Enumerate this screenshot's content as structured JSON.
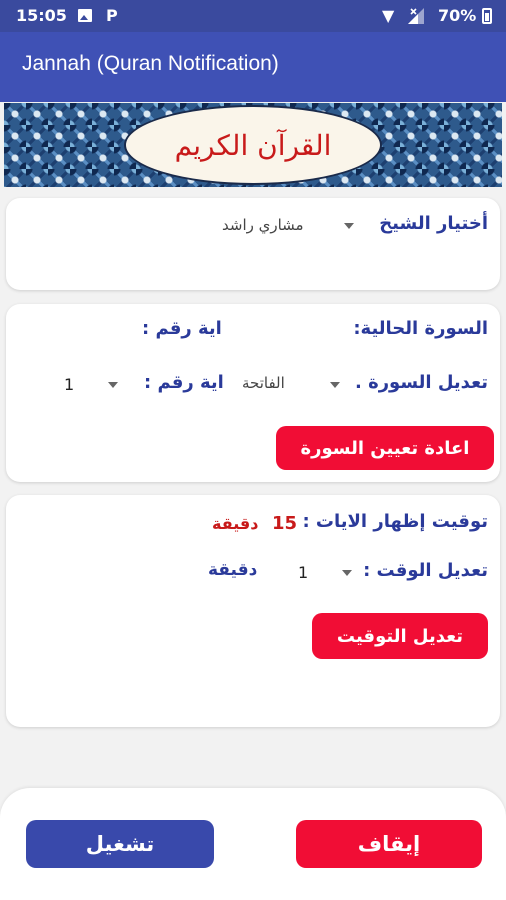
{
  "status_bar": {
    "time": "15:05",
    "p_icon": "P",
    "battery": "70%",
    "icons": [
      "photo-icon",
      "p-icon",
      "wifi-icon",
      "signal-icon",
      "battery-icon"
    ]
  },
  "app_bar": {
    "title": "Jannah (Quran Notification)",
    "color": "#3f51b5"
  },
  "banner": {
    "title": "القرآن الكريم"
  },
  "reciter": {
    "label": "أختيار الشيخ",
    "selected": "مشاري راشد"
  },
  "current": {
    "surah_label": "السورة الحالية:",
    "ayah_label": "اية رقم :"
  },
  "edit_surah": {
    "surah_label": "تعديل السورة .",
    "surah_selected": "الفاتحة",
    "ayah_label": "اية رقم :",
    "ayah_selected": "1",
    "reset_button": "اعادة تعيين السورة"
  },
  "timing": {
    "label": "توقيت إظهار الايات :",
    "value": "15",
    "unit": "دقيقة",
    "edit_label": "تعديل الوقت :",
    "edit_selected": "1",
    "edit_unit": "دقيقة",
    "edit_button": "تعديل التوقيت"
  },
  "controls": {
    "start_button": "تشغيل",
    "stop_button": "إيقاف"
  },
  "colors": {
    "accent_red": "#f10d35",
    "accent_blue": "#3949ab",
    "label_blue": "#2a3a9a",
    "value_red": "#c81a1a"
  }
}
